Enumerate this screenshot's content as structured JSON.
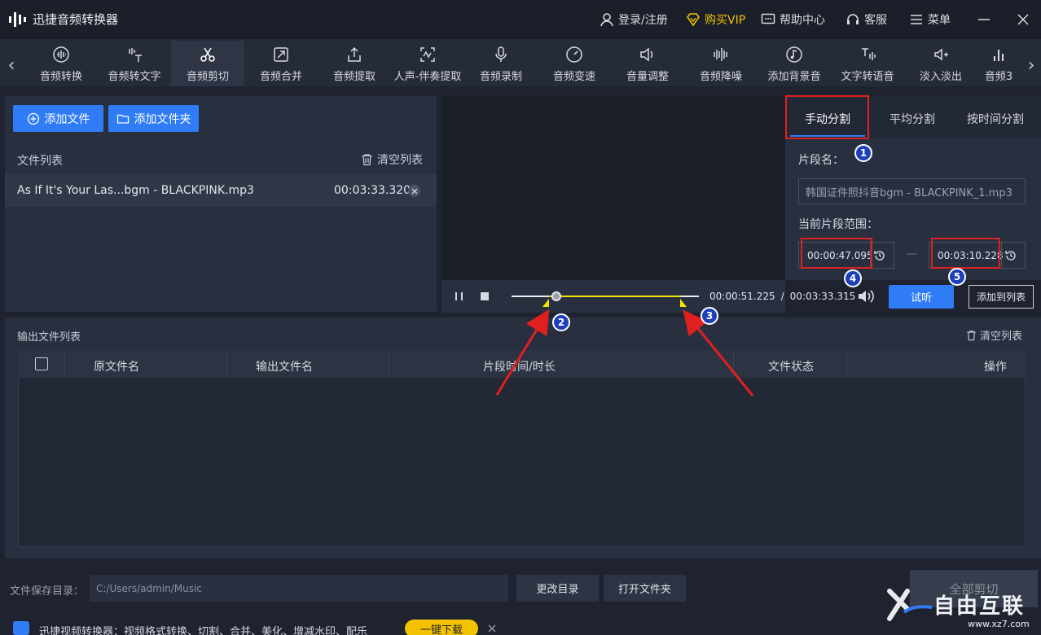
{
  "app": {
    "title": "迅捷音频转换器"
  },
  "titlebar": {
    "login": "登录/注册",
    "vip": "购买VIP",
    "help": "帮助中心",
    "service": "客服",
    "menu": "菜单"
  },
  "toolbar": {
    "tools": [
      {
        "label": "音频转换",
        "icon": "waveform-icon"
      },
      {
        "label": "音频转文字",
        "icon": "speech-to-text-icon"
      },
      {
        "label": "音频剪切",
        "icon": "scissors-icon",
        "active": true
      },
      {
        "label": "音频合并",
        "icon": "merge-icon"
      },
      {
        "label": "音频提取",
        "icon": "upload-icon"
      },
      {
        "label": "人声-伴奏提取",
        "icon": "vocal-extract-icon"
      },
      {
        "label": "音频录制",
        "icon": "microphone-icon"
      },
      {
        "label": "音频变速",
        "icon": "speed-gauge-icon"
      },
      {
        "label": "音量调整",
        "icon": "volume-icon"
      },
      {
        "label": "音频降噪",
        "icon": "denoise-icon"
      },
      {
        "label": "添加背景音",
        "icon": "music-note-icon"
      },
      {
        "label": "文字转语音",
        "icon": "text-to-speech-icon"
      },
      {
        "label": "淡入淡出",
        "icon": "fade-icon"
      },
      {
        "label": "音频3",
        "icon": "bars-icon"
      }
    ]
  },
  "left": {
    "add_file": "添加文件",
    "add_folder": "添加文件夹",
    "file_list_label": "文件列表",
    "clear_list": "清空列表",
    "files": [
      {
        "name": "As If It's Your Las...bgm - BLACKPINK.mp3",
        "duration": "00:03:33.320"
      }
    ]
  },
  "player": {
    "current_time": "00:00:51.225",
    "separator": "/",
    "total_time": "00:03:33.315",
    "progress_fraction": 0.24,
    "selection_start_fraction": 0.2,
    "selection_end_fraction": 0.9,
    "preview_button": "试听",
    "add_to_list_button": "添加到列表"
  },
  "split": {
    "tabs": [
      "手动分割",
      "平均分割",
      "按时间分割"
    ],
    "segment_name_label": "片段名：",
    "segment_name_value": "韩国证件照抖音bgm - BLACKPINK_1.mp3",
    "range_label": "当前片段范围：",
    "range_start": "00:00:47.095",
    "range_dash": "—",
    "range_end": "00:03:10.228"
  },
  "output": {
    "title": "输出文件列表",
    "clear_list": "清空列表",
    "columns": [
      "原文件名",
      "输出文件名",
      "片段时间/时长",
      "文件状态",
      "操作"
    ]
  },
  "bottom": {
    "save_dir_label": "文件保存目录：",
    "save_dir_value": "C:/Users/admin/Music",
    "change_dir": "更改目录",
    "open_folder": "打开文件夹",
    "cut_all": "全部剪切",
    "promo_text": "迅捷视频转换器：视频格式转换、切割、合并、美化、增减水印、配乐",
    "promo_button": "一键下载",
    "watermark": "自由互联",
    "watermark_url": "www.xz7.com"
  },
  "annotations": [
    "1",
    "2",
    "3",
    "4",
    "5"
  ],
  "colors": {
    "accent": "#2f7cf6",
    "highlight_box": "#e02020",
    "selection": "#f5e400",
    "vip": "#f2c200"
  }
}
